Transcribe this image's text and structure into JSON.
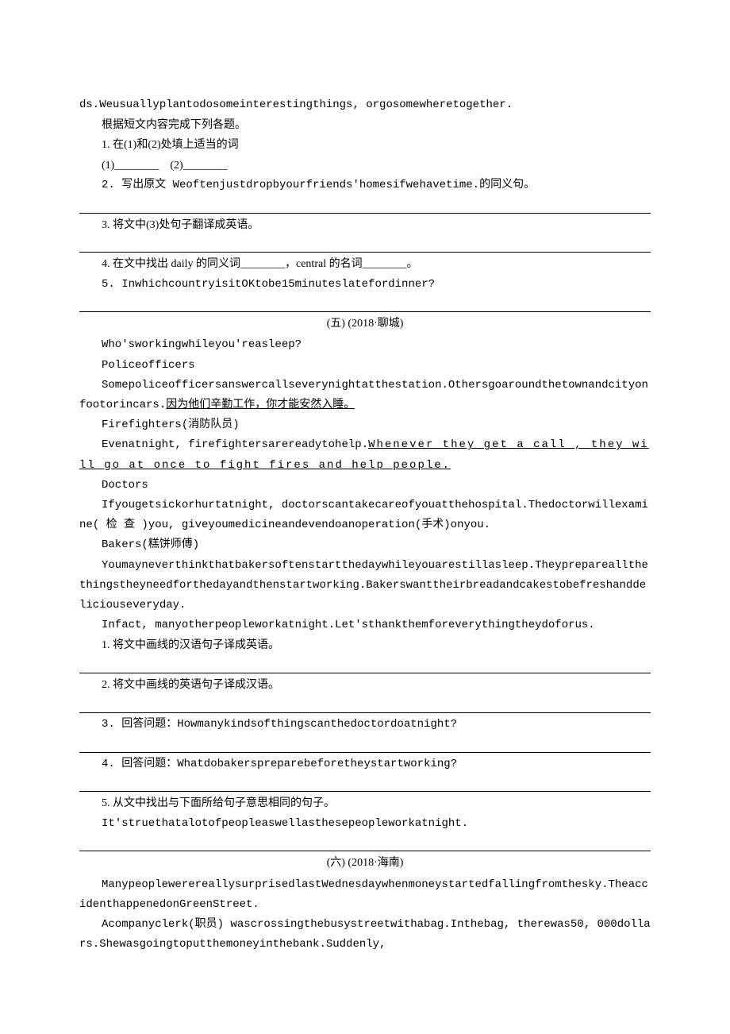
{
  "top_fragment": "ds.Weusuallyplantodosomeinterestingthings, orgosomewheretogether.",
  "section4": {
    "intro": "根据短文内容完成下列各题。",
    "q1_label": "1. 在(1)和(2)处填上适当的词",
    "q1_blanks": "(1)________　(2)________",
    "q2": "2. 写出原文 Weoftenjustdropbyourfriends'homesifwehavetime.的同义句。",
    "q3": "3. 将文中(3)处句子翻译成英语。",
    "q4_a": "4. 在文中找出 daily 的同义词________",
    "q4_b": "，central 的名词________",
    "q4_c": "。",
    "q5": "5. InwhichcountryisitOKtobe15minuteslatefordinner?"
  },
  "section5": {
    "title": "(五) (2018·聊城)",
    "p1": "Who'sworkingwhileyou'reasleep?",
    "h1": "Policeofficers",
    "p2a": "Somepoliceofficersanswercallseverynightatthestation.Othersgoaroundthetownandcityonfootorincars.",
    "p2b": "因为他们辛勤工作，你才能安然入睡。",
    "h2": "Firefighters(消防队员)",
    "p3a": "Evenatnight, firefightersarereadytohelp.",
    "p3b": "Whenever they get a call , they will go at once to fight fires and help people.",
    "h3": "Doctors",
    "p4": "Ifyougetsickorhurtatnight, doctorscantakecareofyouatthehospital.Thedoctorwillexamine( 检 查 )you, giveyoumedicineandevendoanoperation(手术)onyou.",
    "h4": "Bakers(糕饼师傅)",
    "p5": "Youmayneverthinkthatbakersoftenstartthedaywhileyouarestillasleep.Theyprepareallthethingstheyneedforthedayandthenstartworking.Bakerswanttheirbreadandcakestobefreshanddeliciouseveryday.",
    "p6": "Infact, manyotherpeopleworkatnight.Let'sthankthemforeverythingtheydoforus.",
    "q1": "1. 将文中画线的汉语句子译成英语。",
    "q2": "2. 将文中画线的英语句子译成汉语。",
    "q3": "3. 回答问题：Howmanykindsofthingscanthedoctordoatnight?",
    "q4": "4. 回答问题：Whatdobakerspreparebeforetheystartworking?",
    "q5a": "5. 从文中找出与下面所给句子意思相同的句子。",
    "q5b": "It'struethatalotofpeopleaswellasthesepeopleworkatnight."
  },
  "section6": {
    "title": "(六) (2018·海南)",
    "p1": "ManypeoplewerereallysurprisedlastWednesdaywhenmoneystartedfallingfromthesky.TheaccidenthappenedonGreenStreet.",
    "p2": "Acompanyclerk(职员) wascrossingthebusystreetwithabag.Inthebag, therewas50, 000dollars.Shewasgoingtoputthemoneyinthebank.Suddenly,"
  }
}
